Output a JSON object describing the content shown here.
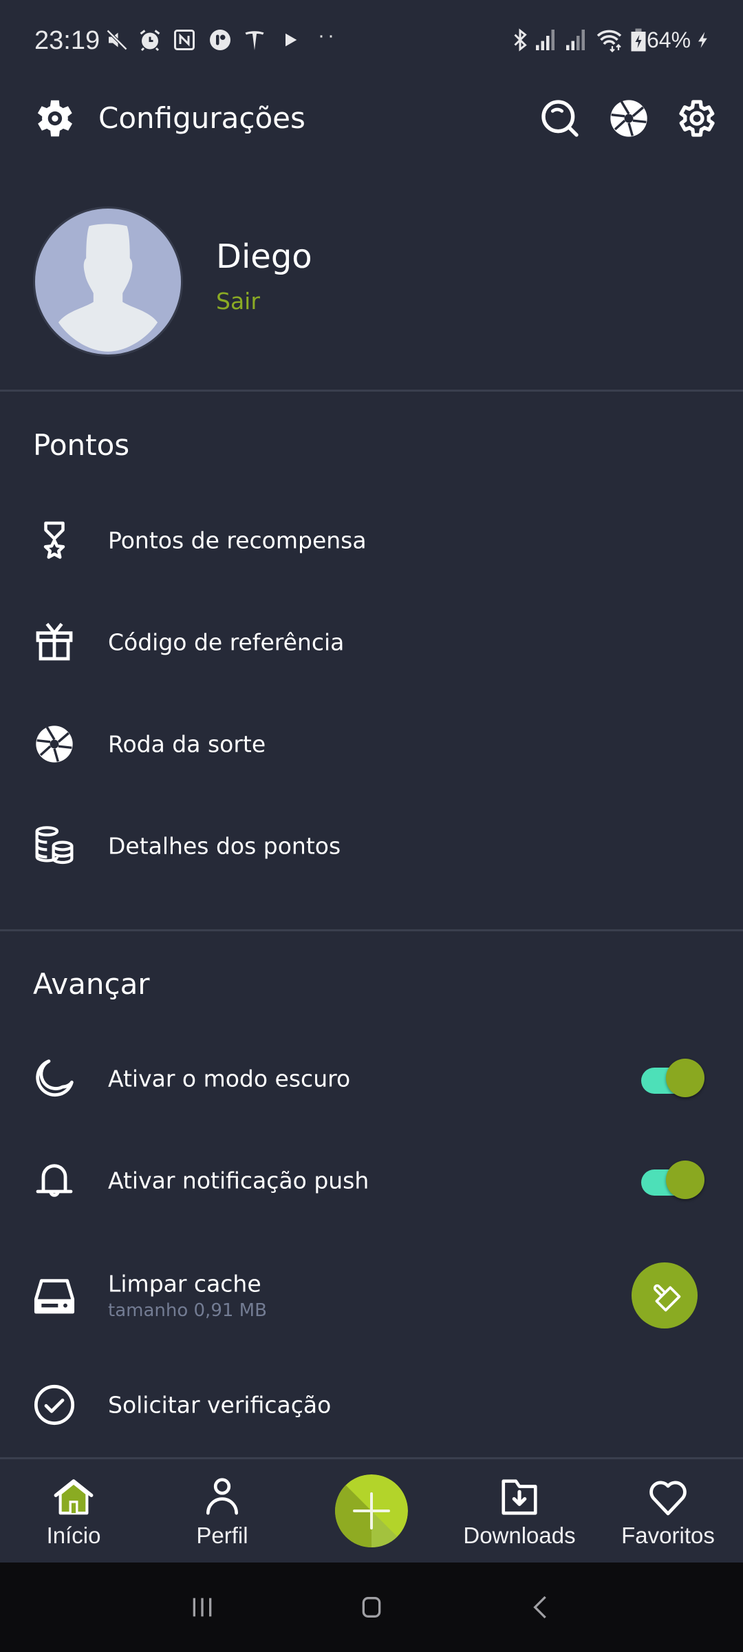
{
  "status_bar": {
    "time": "23:19",
    "battery_percent": "64%",
    "left_icons": [
      "mute-icon",
      "alarm-icon",
      "nfc-icon",
      "app-notification-icon",
      "tesla-icon",
      "play-store-icon",
      "more-notifications-icon"
    ],
    "right_icons": [
      "bluetooth-icon",
      "signal-sim1-icon",
      "signal-sim2-icon",
      "wifi-icon",
      "battery-charging-icon",
      "charging-bolt-icon"
    ]
  },
  "header": {
    "title": "Configurações",
    "icon": "gear-icon",
    "actions": [
      {
        "name": "search-button",
        "icon": "search-icon"
      },
      {
        "name": "lucky-wheel-button",
        "icon": "aperture-icon"
      },
      {
        "name": "settings-button",
        "icon": "gear-outline-icon"
      }
    ]
  },
  "profile": {
    "name": "Diego",
    "logout_label": "Sair",
    "avatar": "default-avatar-silhouette"
  },
  "sections": {
    "points": {
      "title": "Pontos",
      "items": [
        {
          "label": "Pontos de recompensa",
          "icon": "medal-icon"
        },
        {
          "label": "Código de referência",
          "icon": "gift-icon"
        },
        {
          "label": "Roda da sorte",
          "icon": "aperture-icon"
        },
        {
          "label": "Detalhes dos pontos",
          "icon": "coins-icon"
        }
      ]
    },
    "advanced": {
      "title": "Avançar",
      "items": [
        {
          "label": "Ativar o modo escuro",
          "icon": "moon-icon",
          "toggle": true,
          "toggle_on": true
        },
        {
          "label": "Ativar notificação push",
          "icon": "bell-icon",
          "toggle": true,
          "toggle_on": true
        },
        {
          "label": "Limpar cache",
          "sublabel": "tamanho 0,91 MB",
          "icon": "hard-drive-icon",
          "action_icon": "brush-icon"
        },
        {
          "label": "Solicitar verificação",
          "icon": "check-circle-icon"
        }
      ]
    }
  },
  "bottom_nav": {
    "items": [
      {
        "label": "Início",
        "icon": "home-icon",
        "active": true
      },
      {
        "label": "Perfil",
        "icon": "person-icon",
        "active": false
      },
      {
        "label": "",
        "icon": "plus-icon",
        "fab": true
      },
      {
        "label": "Downloads",
        "icon": "folder-download-icon",
        "active": false
      },
      {
        "label": "Favoritos",
        "icon": "heart-icon",
        "active": false
      }
    ]
  },
  "system_nav": {
    "buttons": [
      "recent-apps-icon",
      "home-button-icon",
      "back-icon"
    ]
  },
  "colors": {
    "background": "#262a38",
    "accent_green": "#8bab24",
    "fab_light": "#b5d62a",
    "toggle_track": "#4de0b8",
    "divider": "#3a3f4e",
    "subtext": "#737c93"
  }
}
